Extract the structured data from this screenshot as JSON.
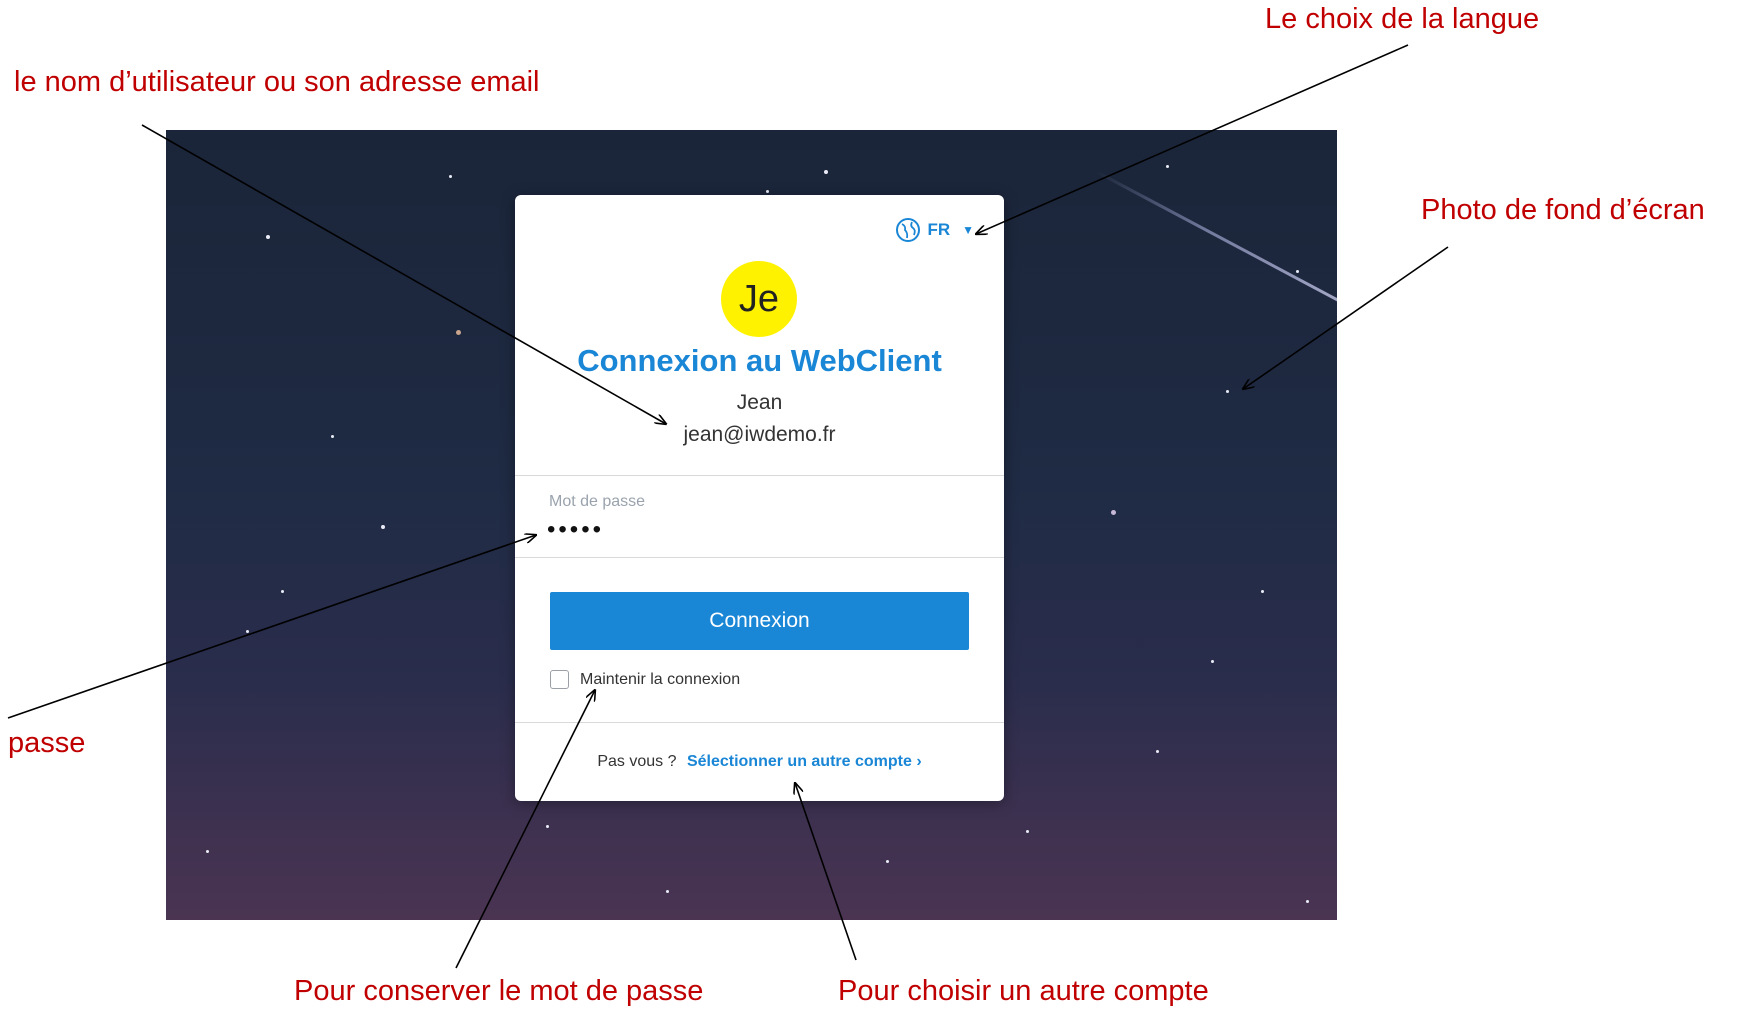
{
  "login": {
    "language": "FR",
    "avatar_initials": "Je",
    "title": "Connexion au WebClient",
    "user_name": "Jean",
    "user_email": "jean@iwdemo.fr",
    "password_label": "Mot de passe",
    "password_value": "•••••",
    "submit_label": "Connexion",
    "remember_label": "Maintenir la connexion",
    "not_you_question": "Pas vous ?",
    "switch_account_link": "Sélectionner un autre compte ›"
  },
  "annotations": {
    "username": "le nom d’utilisateur ou son adresse email",
    "language": "Le choix de la langue",
    "background": "Photo de fond d’écran",
    "password": "passe",
    "remember": "Pour conserver le mot de passe",
    "switch_account": "Pour choisir un autre compte"
  },
  "colors": {
    "accent": "#1a86d6",
    "annotation": "#c00000",
    "avatar": "#fff200"
  },
  "icons": {
    "language": "globe-icon",
    "dropdown": "caret-down-icon"
  }
}
